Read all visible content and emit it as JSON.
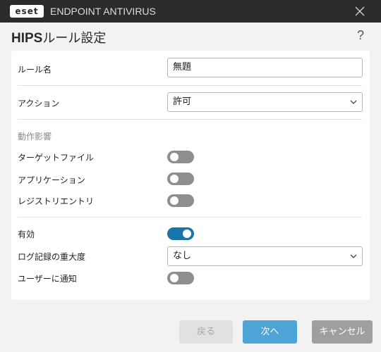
{
  "titlebar": {
    "logo_text": "eset",
    "product_name": "ENDPOINT ANTIVIRUS"
  },
  "dialog": {
    "title_bold": "HIPS",
    "title_rest": "ルール設定",
    "help_label": "?"
  },
  "form": {
    "rule_name": {
      "label": "ルール名",
      "value": "無題"
    },
    "action": {
      "label": "アクション",
      "selected": "許可"
    },
    "section_header": "動作影響",
    "target_files": {
      "label": "ターゲットファイル",
      "on": false
    },
    "applications": {
      "label": "アプリケーション",
      "on": false
    },
    "registry_entries": {
      "label": "レジストリエントリ",
      "on": false
    },
    "enabled": {
      "label": "有効",
      "on": true
    },
    "log_severity": {
      "label": "ログ記録の重大度",
      "selected": "なし"
    },
    "notify_user": {
      "label": "ユーザーに通知",
      "on": false
    }
  },
  "buttons": {
    "back": "戻る",
    "next": "次へ",
    "cancel": "キャンセル"
  },
  "colors": {
    "titlebar": "#2b2b2b",
    "toggle_on": "#1a75a8",
    "toggle_off": "#8e8e8e",
    "next_button": "#4ea4d6",
    "cancel_button": "#9f9f9f"
  }
}
